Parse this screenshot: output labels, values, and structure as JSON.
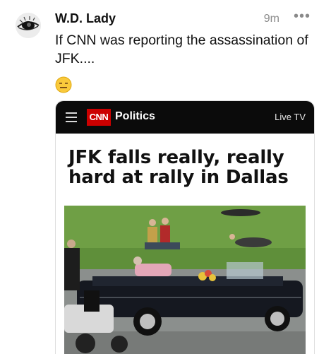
{
  "post": {
    "author": "W.D. Lady",
    "time": "9m",
    "more_label": "•••",
    "text": "If CNN was reporting the assassination of JFK....",
    "emoji": "😑"
  },
  "card": {
    "logo_text": "CNN",
    "section": "Politics",
    "live_label": "Live TV",
    "headline": "JFK falls really, really hard at rally in Dallas"
  }
}
